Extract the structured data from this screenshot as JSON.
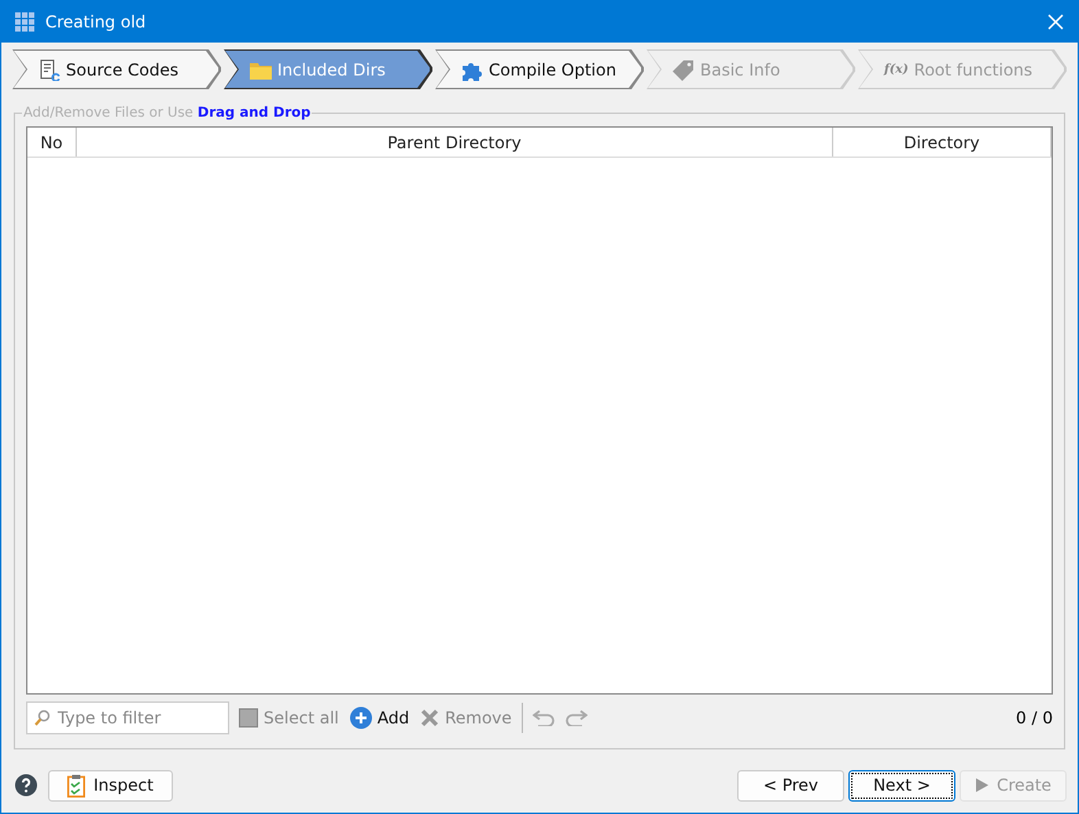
{
  "window": {
    "title": "Creating old"
  },
  "steps": [
    {
      "label": "Source Codes",
      "kind": "source",
      "selected": false,
      "disabled": false
    },
    {
      "label": "Included Dirs",
      "kind": "folder",
      "selected": true,
      "disabled": false
    },
    {
      "label": "Compile Option",
      "kind": "puzzle",
      "selected": false,
      "disabled": false
    },
    {
      "label": "Basic Info",
      "kind": "tag",
      "selected": false,
      "disabled": true
    },
    {
      "label": "Root functions",
      "kind": "function",
      "glyph": "f(x)",
      "selected": false,
      "disabled": true
    }
  ],
  "group": {
    "legend": "Add/Remove Files or Use **Drag and Drop**"
  },
  "table": {
    "columns": [
      "No",
      "Parent Directory",
      "Directory"
    ]
  },
  "toolbar": {
    "filter": {
      "placeholder": "Type to filter"
    },
    "select_all": {
      "label": "Select all",
      "checked": false,
      "disabled": true
    },
    "add": {
      "label": "Add",
      "disabled": false
    },
    "remove": {
      "label": "Remove",
      "disabled": true
    },
    "undo": {
      "disabled": true
    },
    "redo": {
      "disabled": true
    },
    "count": "0 / 0"
  },
  "footer": {
    "inspect": "Inspect",
    "prev": {
      "label": "< Prev",
      "disabled": false,
      "focused": false
    },
    "next": {
      "label": "Next >",
      "disabled": false,
      "focused": true
    },
    "create": {
      "label": "Create",
      "disabled": true,
      "focused": false
    }
  }
}
